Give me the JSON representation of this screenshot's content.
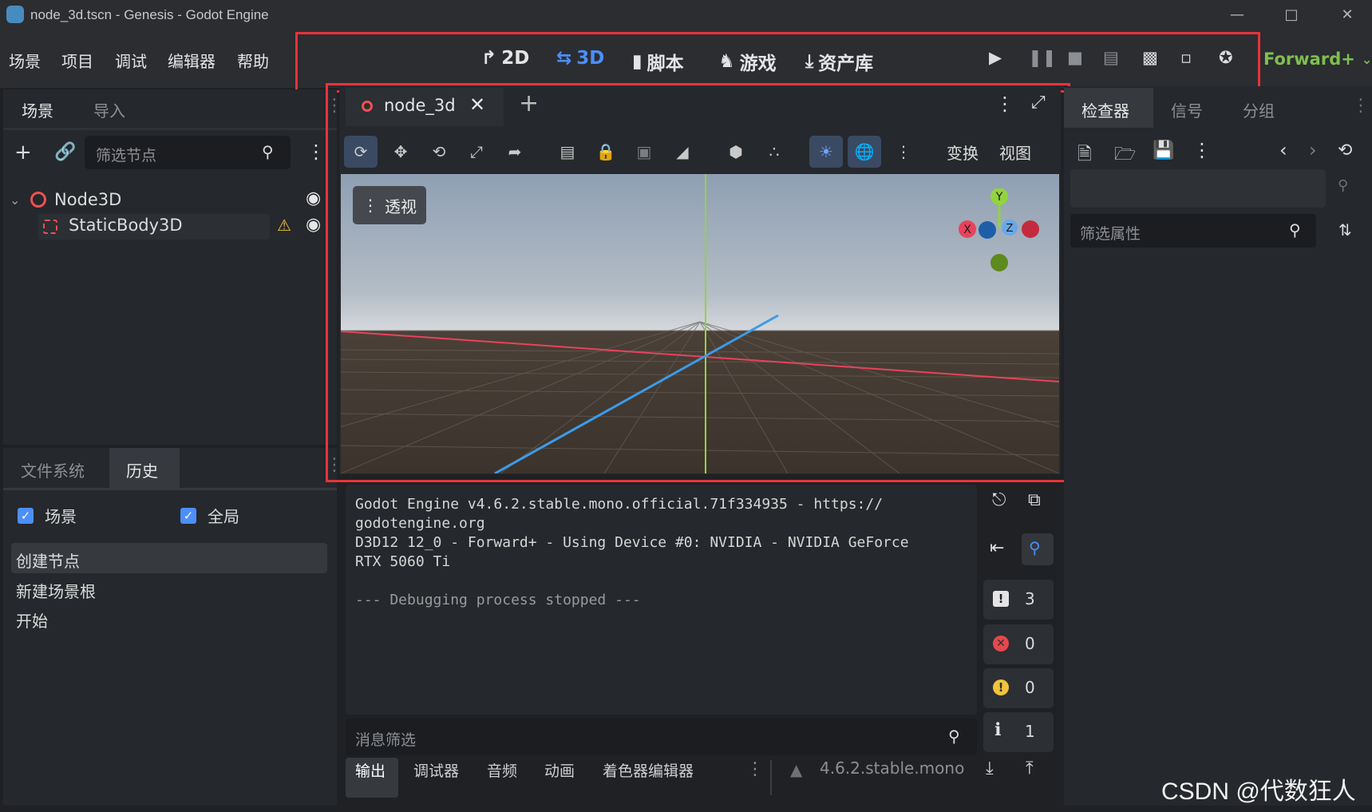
{
  "window": {
    "title": "node_3d.tscn - Genesis - Godot Engine"
  },
  "menu": [
    "场景",
    "项目",
    "调试",
    "编辑器",
    "帮助"
  ],
  "modes": [
    {
      "label": "2D",
      "icon": "2d-icon"
    },
    {
      "label": "3D",
      "icon": "3d-icon",
      "active": true
    },
    {
      "label": "脚本",
      "icon": "script-icon"
    },
    {
      "label": "游戏",
      "icon": "game-icon"
    },
    {
      "label": "资产库",
      "icon": "asset-lib-icon"
    }
  ],
  "renderer": "Forward+",
  "left": {
    "tabs": [
      "场景",
      "导入"
    ],
    "filter_placeholder": "筛选节点",
    "tree": [
      {
        "name": "Node3D"
      },
      {
        "name": "StaticBody3D",
        "warning": true
      }
    ],
    "bottom_tabs": [
      "文件系统",
      "历史"
    ],
    "history": {
      "check_scene": "场景",
      "check_global": "全局",
      "items": [
        "创建节点",
        "新建场景根",
        "开始"
      ]
    }
  },
  "editor": {
    "scene_tab": "node_3d",
    "toolbar_transform": "变换",
    "toolbar_view": "视图",
    "perspective": "透视",
    "gizmo": {
      "y": "Y",
      "x": "X",
      "z": "Z"
    }
  },
  "output": {
    "lines": [
      "Godot Engine v4.6.2.stable.mono.official.71f334935 - https://",
      "godotengine.org",
      "D3D12 12_0 - Forward+ - Using Device #0: NVIDIA - NVIDIA GeForce",
      "RTX 5060 Ti",
      "",
      "--- Debugging process stopped ---"
    ],
    "filter_placeholder": "消息筛选",
    "counts": {
      "messages": "3",
      "errors": "0",
      "warnings": "0",
      "info": "1"
    }
  },
  "bottom_tabs": [
    "输出",
    "调试器",
    "音频",
    "动画",
    "着色器编辑器"
  ],
  "version": "4.6.2.stable.mono",
  "right": {
    "tabs": [
      "检查器",
      "信号",
      "分组"
    ],
    "filter_placeholder": "筛选属性"
  },
  "watermark": "CSDN @代数狂人",
  "colors": {
    "accent": "#4b8ff7",
    "renderer": "#7fbf4f",
    "highlight": "#e8333a"
  }
}
